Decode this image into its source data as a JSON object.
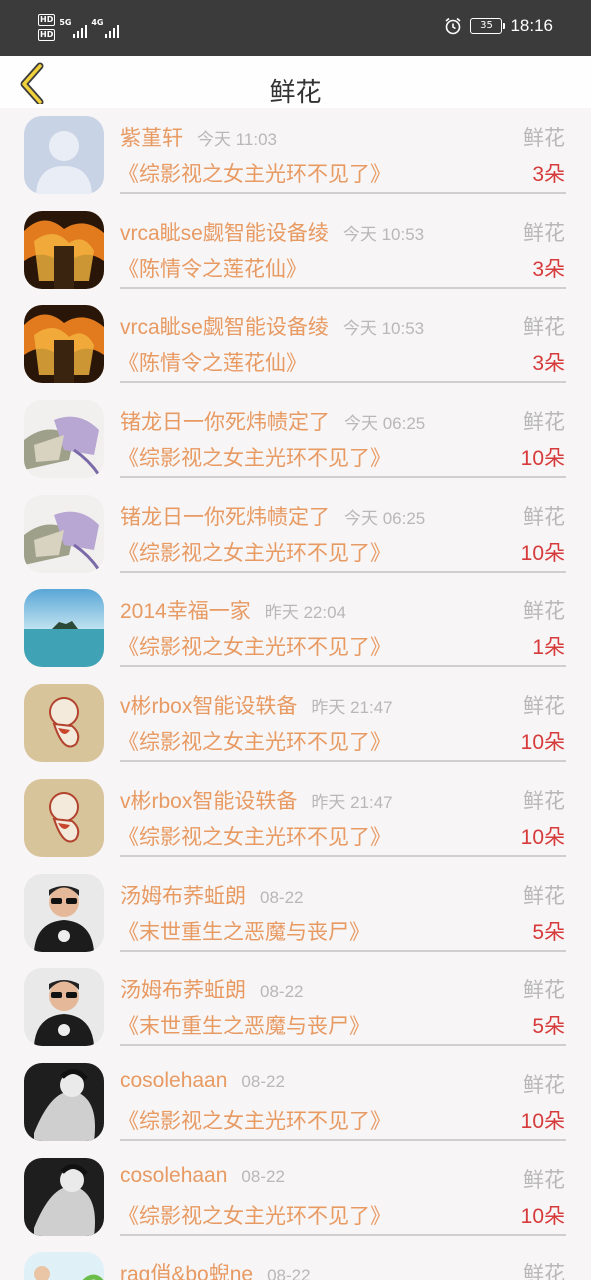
{
  "status_bar": {
    "hd1": "HD",
    "hd2": "HD",
    "net1": "5G",
    "net2": "4G",
    "battery": "35",
    "time": "18:16"
  },
  "header": {
    "title": "鲜花"
  },
  "colors": {
    "accent": "#e89a63",
    "count": "#d63a3a",
    "muted": "#b8b8b8"
  },
  "items": [
    {
      "name": "紫堇轩",
      "time": "今天 11:03",
      "type": "鲜花",
      "book": "《综影视之女主光环不见了》",
      "count": "3朵",
      "avatar": "default-avatar"
    },
    {
      "name": "vrca眦se觑智能设备绫",
      "time": "今天 10:53",
      "type": "鲜花",
      "book": "《陈情令之莲花仙》",
      "count": "3朵",
      "avatar": "fire-avatar"
    },
    {
      "name": "vrca眦se觑智能设备绫",
      "time": "今天 10:53",
      "type": "鲜花",
      "book": "《陈情令之莲花仙》",
      "count": "3朵",
      "avatar": "fire-avatar"
    },
    {
      "name": "锗龙日一你死炜帻定了",
      "time": "今天 06:25",
      "type": "鲜花",
      "book": "《综影视之女主光环不见了》",
      "count": "10朵",
      "avatar": "fabric-avatar"
    },
    {
      "name": "锗龙日一你死炜帻定了",
      "time": "今天 06:25",
      "type": "鲜花",
      "book": "《综影视之女主光环不见了》",
      "count": "10朵",
      "avatar": "fabric-avatar"
    },
    {
      "name": "2014幸福一家",
      "time": "昨天 22:04",
      "type": "鲜花",
      "book": "《综影视之女主光环不见了》",
      "count": "1朵",
      "avatar": "sea-avatar"
    },
    {
      "name": "v彬rbox智能设轶备",
      "time": "昨天 21:47",
      "type": "鲜花",
      "book": "《综影视之女主光环不见了》",
      "count": "10朵",
      "avatar": "cartoon-avatar"
    },
    {
      "name": "v彬rbox智能设轶备",
      "time": "昨天 21:47",
      "type": "鲜花",
      "book": "《综影视之女主光环不见了》",
      "count": "10朵",
      "avatar": "cartoon-avatar"
    },
    {
      "name": "汤姆布荞蚯朗",
      "time": "08-22",
      "type": "鲜花",
      "book": "《末世重生之恶魔与丧尸》",
      "count": "5朵",
      "avatar": "skull-avatar"
    },
    {
      "name": "汤姆布荞蚯朗",
      "time": "08-22",
      "type": "鲜花",
      "book": "《末世重生之恶魔与丧尸》",
      "count": "5朵",
      "avatar": "skull-avatar"
    },
    {
      "name": "cosolehaan",
      "time": "08-22",
      "type": "鲜花",
      "book": "《综影视之女主光环不见了》",
      "count": "10朵",
      "avatar": "bw-avatar"
    },
    {
      "name": "cosolehaan",
      "time": "08-22",
      "type": "鲜花",
      "book": "《综影视之女主光环不见了》",
      "count": "10朵",
      "avatar": "bw-avatar"
    },
    {
      "name": "rag俏&bo蜺ne",
      "time": "08-22",
      "type": "鲜花",
      "book": "",
      "count": "",
      "avatar": "kid-avatar"
    }
  ]
}
